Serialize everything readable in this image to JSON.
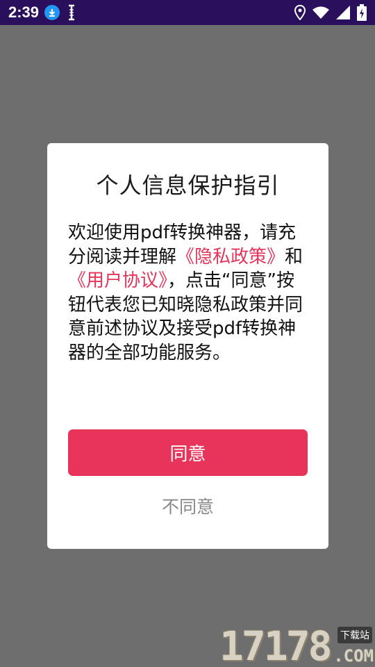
{
  "status_bar": {
    "time": "2:39",
    "icons": [
      "download-icon",
      "text-cursor-icon",
      "location-icon",
      "wifi-icon",
      "signal-icon",
      "battery-charging-icon"
    ]
  },
  "dialog": {
    "title": "个人信息保护指引",
    "body": {
      "seg1": "欢迎使用pdf转换神器，请充分阅读并理解",
      "privacy_link": "《隐私政策》",
      "seg2": "和",
      "agreement_link": "《用户协议》",
      "seg3": "，点击“同意”按钮代表您已知晓隐私政策并同意前述协议及接受pdf转换神器的全部功能服务。"
    },
    "agree_label": "同意",
    "disagree_label": "不同意"
  },
  "watermark": {
    "digits": "17178",
    "tag": "下载站",
    "domain": ".COM"
  },
  "colors": {
    "status_bar": "#2a0f5c",
    "scrim": "#6e6e6e",
    "accent": "#e8345a",
    "disagree_text": "#888888"
  }
}
